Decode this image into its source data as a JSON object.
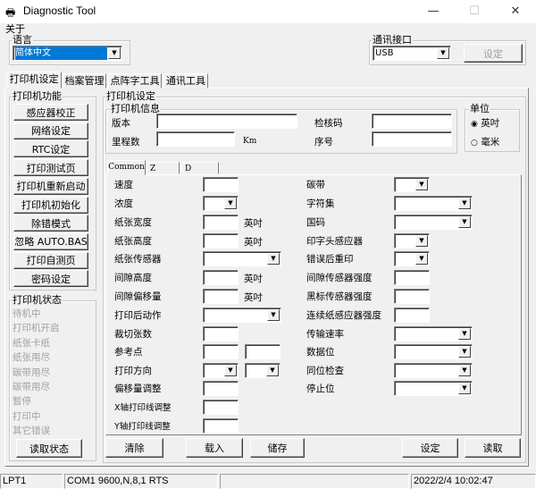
{
  "window": {
    "title": "Diagnostic Tool",
    "minimize": "—",
    "maximize": "☐",
    "close": "✕"
  },
  "menu": {
    "about": "关于"
  },
  "language": {
    "label": "语言",
    "value": "简体中文"
  },
  "comm": {
    "label": "通讯接口",
    "value": "USB",
    "set": "设定"
  },
  "tabs": [
    "打印机设定",
    "档案管理",
    "点阵字工具",
    "通讯工具"
  ],
  "functions": {
    "label": "打印机功能",
    "buttons": [
      "感应器校正",
      "网络设定",
      "RTC设定",
      "打印测试页",
      "打印机重新启动",
      "打印机初始化",
      "除错模式",
      "忽略 AUTO.BAS",
      "打印自测页",
      "密码设定"
    ]
  },
  "status": {
    "label": "打印机状态",
    "items": [
      "待机中",
      "打印机开启",
      "纸张卡纸",
      "纸张用尽",
      "碳带用尽",
      "碳带用尽",
      "暂停",
      "打印中",
      "其它错误"
    ],
    "read": "读取状态"
  },
  "settings": {
    "label": "打印机设定",
    "info": {
      "label": "打印机信息",
      "version": "版本",
      "mileage": "里程数",
      "km": "Km",
      "checksum": "检核码",
      "serial": "序号"
    },
    "unit": {
      "label": "单位",
      "inch": "英吋",
      "mm": "毫米",
      "selected": "英吋"
    },
    "subtabs": [
      "Common",
      "Z",
      "D"
    ],
    "inch": "英吋",
    "left": [
      "速度",
      "浓度",
      "纸张宽度",
      "纸张高度",
      "纸张传感器",
      "间隙高度",
      "间隙偏移量",
      "打印后动作",
      "裁切张数",
      "参考点",
      "打印方向",
      "偏移量调整",
      "X轴打印线调整",
      "Y轴打印线调整"
    ],
    "right": [
      "碳带",
      "字符集",
      "国码",
      "印字头感应器",
      "错误后重印",
      "间隙传感器强度",
      "黑标传感器强度",
      "连续纸感应器强度",
      "传输速率",
      "数据位",
      "同位检查",
      "停止位"
    ],
    "buttons": {
      "clear": "清除",
      "load": "载入",
      "save": "储存",
      "set": "设定",
      "read": "读取"
    }
  },
  "statusbar": {
    "port": "LPT1",
    "com": "COM1 9600,N,8,1 RTS",
    "time": "2022/2/4 10:02:47"
  }
}
